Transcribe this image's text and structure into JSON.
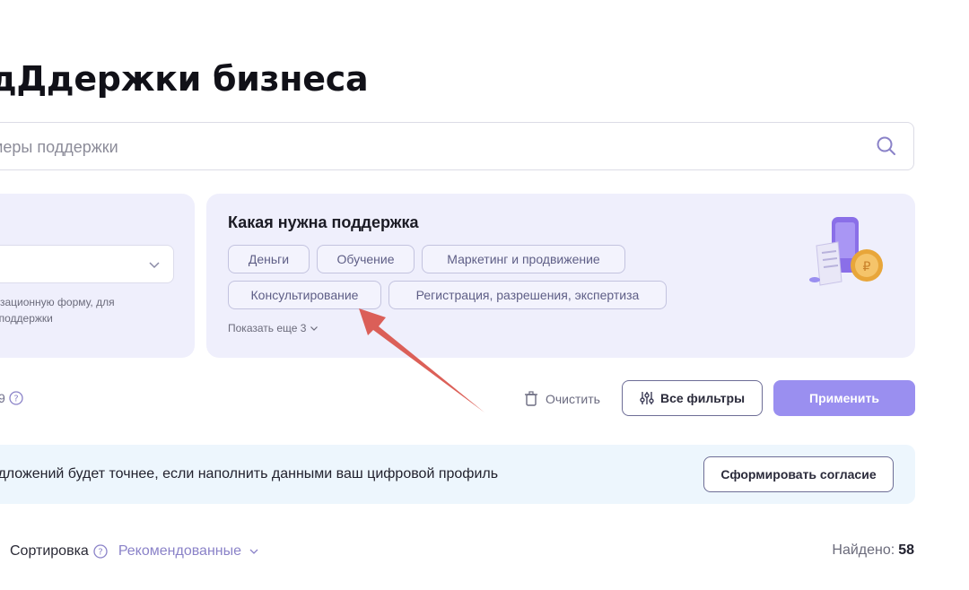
{
  "page": {
    "title": "дДдержки бизнеса"
  },
  "search": {
    "placeholder": "меры поддержки"
  },
  "filters": {
    "org_form_hint": "анизационную форму, для",
    "org_form_hint_2": "ры поддержки"
  },
  "support": {
    "title": "Какая нужна поддержка",
    "chips": [
      "Деньги",
      "Обучение",
      "Маркетинг и продвижение",
      "Консультирование",
      "Регистрация, разрешения, экспертиза"
    ],
    "show_more": "Показать еще 3"
  },
  "actions": {
    "counter": "9",
    "clear_label": "Очистить",
    "all_filters_label": "Все фильтры",
    "apply_label": "Применить"
  },
  "banner": {
    "text": "редложений будет точнее, если наполнить данными ваш цифровой профиль",
    "button_label": "Сформировать согласие"
  },
  "results": {
    "sort_label": "Сортировка",
    "sort_value": "Рекомендованные",
    "found_label": "Найдено:",
    "found_count": "58"
  },
  "colors": {
    "accent": "#9a8ff0",
    "card_bg": "#efeffc",
    "banner_bg": "#edf6fd",
    "arrow": "#d9534a"
  }
}
